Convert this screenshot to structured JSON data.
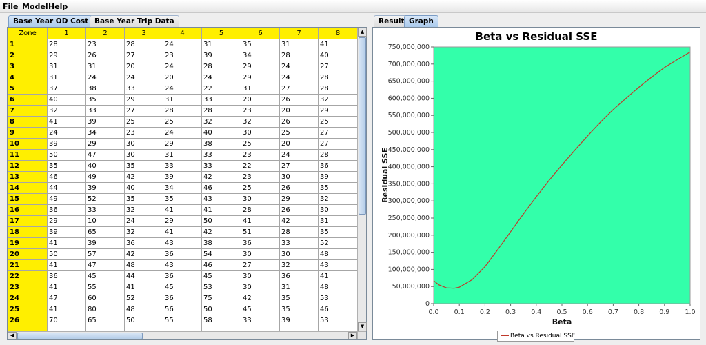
{
  "menu": {
    "items": [
      "File",
      "Model",
      "Help"
    ]
  },
  "left_tabs": [
    "Base Year OD Cost Data",
    "Base Year Trip Data"
  ],
  "right_tabs": [
    "Result",
    "Graph"
  ],
  "table": {
    "headers": [
      "Zone",
      "1",
      "2",
      "3",
      "4",
      "5",
      "6",
      "7",
      "8"
    ],
    "rows": [
      [
        "1",
        "28",
        "23",
        "28",
        "24",
        "31",
        "35",
        "31",
        "41"
      ],
      [
        "2",
        "29",
        "26",
        "27",
        "23",
        "39",
        "34",
        "28",
        "40"
      ],
      [
        "3",
        "31",
        "31",
        "20",
        "24",
        "28",
        "29",
        "24",
        "27"
      ],
      [
        "4",
        "31",
        "24",
        "24",
        "20",
        "24",
        "29",
        "24",
        "28"
      ],
      [
        "5",
        "37",
        "38",
        "33",
        "24",
        "22",
        "31",
        "27",
        "28"
      ],
      [
        "6",
        "40",
        "35",
        "29",
        "31",
        "33",
        "20",
        "26",
        "32"
      ],
      [
        "7",
        "32",
        "33",
        "27",
        "28",
        "28",
        "23",
        "20",
        "29"
      ],
      [
        "8",
        "41",
        "39",
        "25",
        "25",
        "32",
        "32",
        "26",
        "25"
      ],
      [
        "9",
        "24",
        "34",
        "23",
        "24",
        "40",
        "30",
        "25",
        "27"
      ],
      [
        "10",
        "39",
        "29",
        "30",
        "29",
        "38",
        "25",
        "20",
        "27"
      ],
      [
        "11",
        "50",
        "47",
        "30",
        "31",
        "33",
        "23",
        "24",
        "28"
      ],
      [
        "12",
        "35",
        "40",
        "35",
        "33",
        "33",
        "22",
        "27",
        "36"
      ],
      [
        "13",
        "46",
        "49",
        "42",
        "39",
        "42",
        "23",
        "30",
        "39"
      ],
      [
        "14",
        "44",
        "39",
        "40",
        "34",
        "46",
        "25",
        "26",
        "35"
      ],
      [
        "15",
        "49",
        "52",
        "35",
        "35",
        "43",
        "30",
        "29",
        "32"
      ],
      [
        "16",
        "36",
        "33",
        "32",
        "41",
        "41",
        "28",
        "26",
        "30"
      ],
      [
        "17",
        "29",
        "10",
        "24",
        "29",
        "50",
        "41",
        "42",
        "31"
      ],
      [
        "18",
        "39",
        "65",
        "32",
        "41",
        "42",
        "51",
        "28",
        "35"
      ],
      [
        "19",
        "41",
        "39",
        "36",
        "43",
        "38",
        "36",
        "33",
        "52"
      ],
      [
        "20",
        "50",
        "57",
        "42",
        "36",
        "54",
        "30",
        "30",
        "48"
      ],
      [
        "21",
        "41",
        "47",
        "48",
        "43",
        "46",
        "27",
        "32",
        "43"
      ],
      [
        "22",
        "36",
        "45",
        "44",
        "36",
        "45",
        "30",
        "36",
        "41"
      ],
      [
        "23",
        "41",
        "55",
        "41",
        "45",
        "53",
        "30",
        "31",
        "48"
      ],
      [
        "24",
        "47",
        "60",
        "52",
        "36",
        "75",
        "42",
        "35",
        "53"
      ],
      [
        "25",
        "41",
        "80",
        "48",
        "56",
        "50",
        "45",
        "35",
        "46"
      ],
      [
        "26",
        "70",
        "65",
        "50",
        "55",
        "58",
        "33",
        "39",
        "53"
      ]
    ],
    "empty_rows": 2
  },
  "chart_data": {
    "type": "line",
    "title": "Beta vs Residual SSE",
    "xlabel": "Beta",
    "ylabel": "Residual SSE",
    "xlim": [
      0.0,
      1.0
    ],
    "ylim": [
      0,
      750000000
    ],
    "x_ticks": [
      "0.0",
      "0.1",
      "0.2",
      "0.3",
      "0.4",
      "0.5",
      "0.6",
      "0.7",
      "0.8",
      "0.9",
      "1.0"
    ],
    "y_ticks": [
      "0",
      "50,000,000",
      "100,000,000",
      "150,000,000",
      "200,000,000",
      "250,000,000",
      "300,000,000",
      "350,000,000",
      "400,000,000",
      "450,000,000",
      "500,000,000",
      "550,000,000",
      "600,000,000",
      "650,000,000",
      "700,000,000",
      "750,000,000"
    ],
    "grid": false,
    "legend": "bottom-center",
    "plot_background": "#33ffaa",
    "line_color": "#c0392b",
    "series": [
      {
        "name": "Beta vs Residual SSE",
        "x": [
          0.0,
          0.02,
          0.05,
          0.08,
          0.1,
          0.15,
          0.2,
          0.25,
          0.3,
          0.35,
          0.4,
          0.45,
          0.5,
          0.55,
          0.6,
          0.65,
          0.7,
          0.75,
          0.8,
          0.85,
          0.9,
          0.95,
          1.0
        ],
        "y": [
          67000000,
          55000000,
          46000000,
          45000000,
          48000000,
          70000000,
          108000000,
          158000000,
          210000000,
          262000000,
          312000000,
          360000000,
          405000000,
          448000000,
          490000000,
          530000000,
          567000000,
          600000000,
          632000000,
          662000000,
          690000000,
          713000000,
          735000000
        ]
      }
    ]
  }
}
